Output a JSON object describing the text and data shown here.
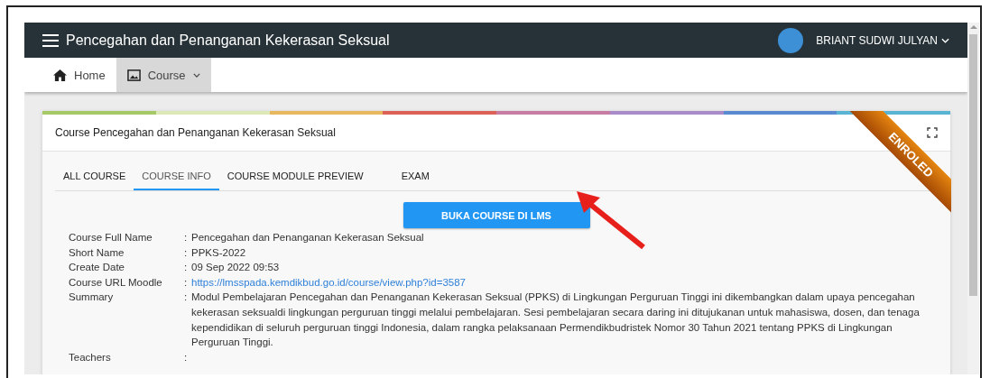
{
  "app_bar": {
    "title": "Pencegahan dan Penanganan Kekerasan Seksual",
    "user": "BRIANT SUDWI JULYAN"
  },
  "nav": [
    {
      "label": "Home",
      "kind": "home",
      "selected": false,
      "dropdown": false
    },
    {
      "label": "Course",
      "kind": "image",
      "selected": true,
      "dropdown": true
    }
  ],
  "card": {
    "title": "Course Pencegahan dan Penanganan Kekerasan Seksual",
    "ribbon": "ENROLED",
    "tabs": [
      {
        "label": "ALL COURSE",
        "selected": false
      },
      {
        "label": "COURSE INFO",
        "selected": true
      },
      {
        "label": "COURSE MODULE PREVIEW",
        "selected": false
      },
      {
        "label": "EXAM",
        "selected": false
      }
    ],
    "button": "BUKA COURSE DI LMS",
    "info": [
      {
        "label": "Course Full Name",
        "kind": "text",
        "value": "Pencegahan dan Penanganan Kekerasan Seksual"
      },
      {
        "label": "Short Name",
        "kind": "text",
        "value": "PPKS-2022"
      },
      {
        "label": "Create Date",
        "kind": "text",
        "value": "09 Sep 2022 09:53"
      },
      {
        "label": "Course URL Moodle",
        "kind": "link",
        "value": "https://lmsspada.kemdikbud.go.id/course/view.php?id=3587"
      },
      {
        "label": "Summary",
        "kind": "text",
        "value": "Modul Pembelajaran Pencegahan dan Penanganan Kekerasan Seksual (PPKS) di Lingkungan Perguruan Tinggi ini dikembangkan dalam upaya pencegahan kekerasan seksualdi lingkungan perguruan tinggi melalui pembelajaran. Sesi pembelajaran secara daring ini ditujukanan untuk mahasiswa, dosen, dan tenaga kependidikan di seluruh perguruan tinggi Indonesia, dalam rangka pelaksanaan Permendikbudristek Nomor 30 Tahun 2021 tentang PPKS di Lingkungan Perguruan Tinggi."
      },
      {
        "label": "Teachers",
        "kind": "empty"
      }
    ],
    "separators": [
      ":",
      ":",
      ":",
      ":",
      ":",
      ":"
    ]
  }
}
